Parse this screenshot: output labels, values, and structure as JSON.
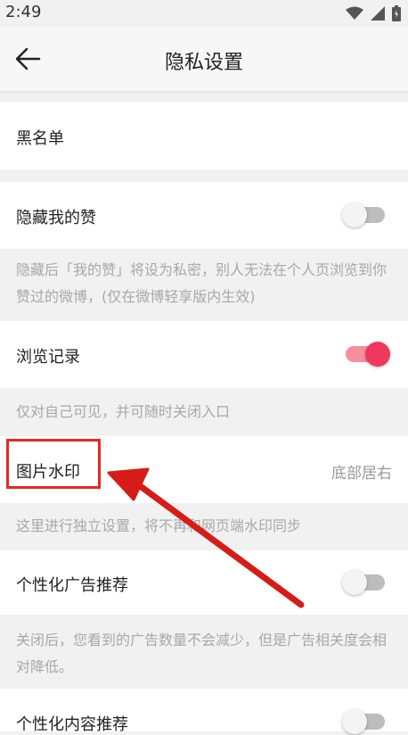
{
  "status": {
    "time": "2:49",
    "icons": [
      "wifi-icon",
      "signal-icon",
      "battery-icon"
    ]
  },
  "header": {
    "title": "隐私设置",
    "back_icon": "arrow-left-icon"
  },
  "rows": {
    "blacklist": {
      "label": "黑名单"
    },
    "hide_likes": {
      "label": "隐藏我的赞",
      "enabled": false,
      "hint": "隐藏后「我的赞」将设为私密，别人无法在个人页浏览到你赞过的微博，(仅在微博轻享版内生效)"
    },
    "history": {
      "label": "浏览记录",
      "enabled": true,
      "hint": "仅对自己可见，并可随时关闭入口"
    },
    "watermark": {
      "label": "图片水印",
      "value": "底部居右",
      "hint": "这里进行独立设置，将不再和网页端水印同步"
    },
    "ad_recommend": {
      "label": "个性化广告推荐",
      "enabled": false,
      "hint": "关闭后，您看到的广告数量不会减少，但是广告相关度会相对降低。"
    },
    "content_recommend": {
      "label": "个性化内容推荐",
      "enabled": false
    }
  },
  "colors": {
    "annotation": "#e8271f",
    "toggle_on": "#f0385c",
    "toggle_off": "#bdbdbd",
    "background": "#f1f1f1"
  }
}
